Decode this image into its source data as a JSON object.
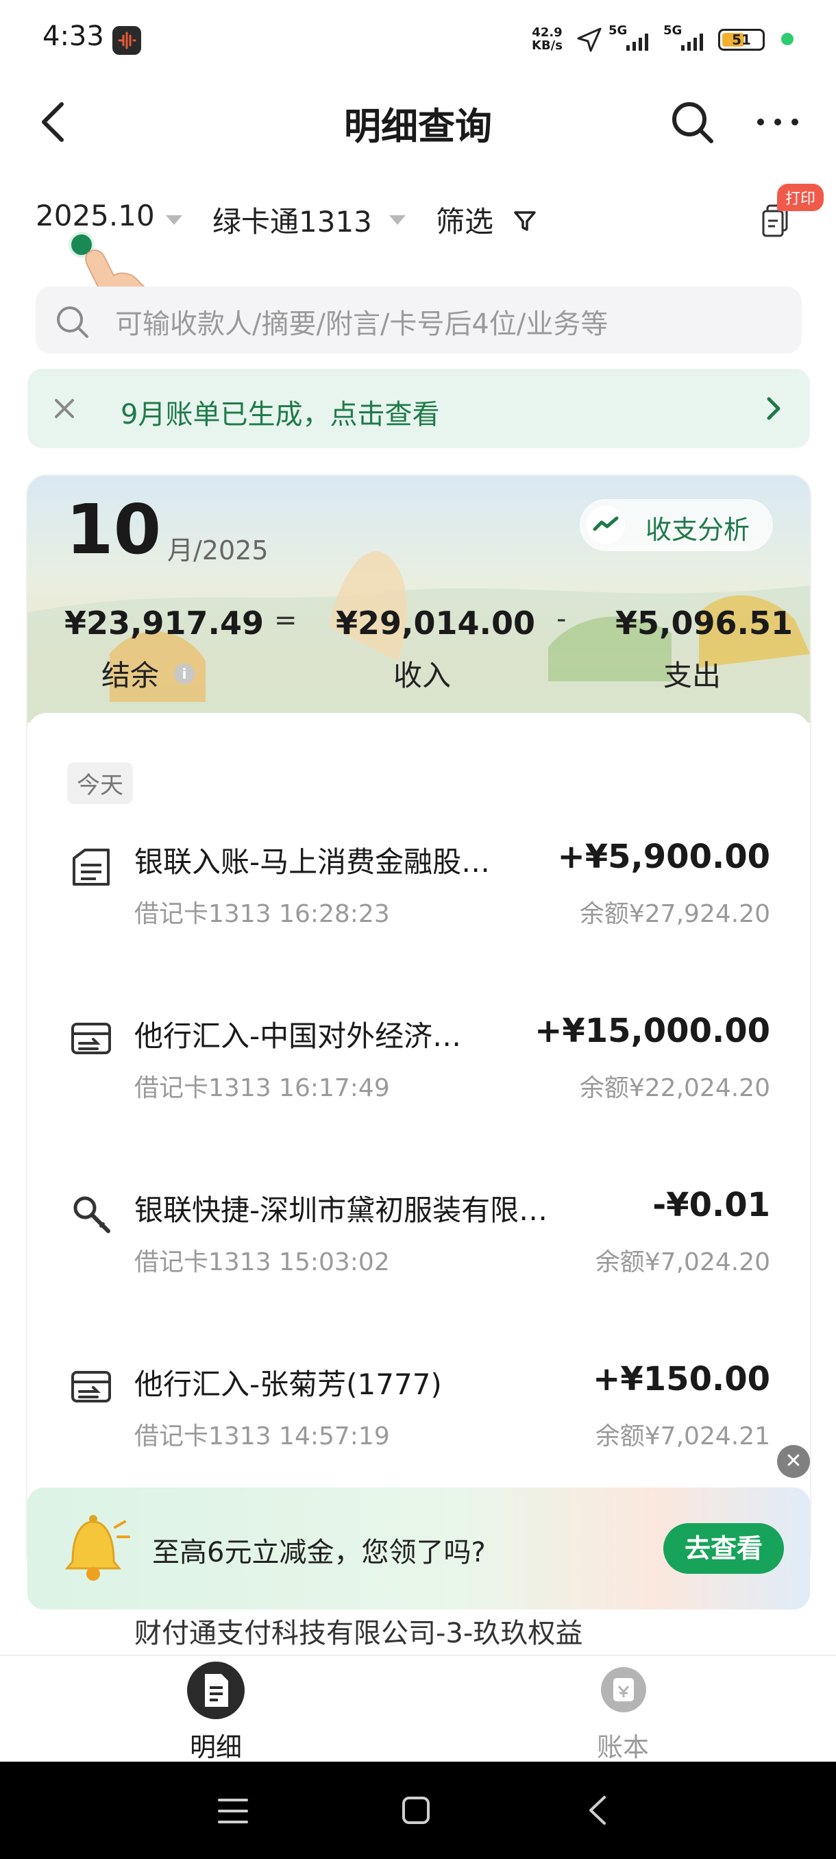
{
  "status_bar": {
    "time": "4:33",
    "net_speed_value": "42.9",
    "net_speed_unit": "KB/s",
    "signal_1": "5G",
    "signal_2": "5G",
    "battery": "51"
  },
  "header": {
    "title": "明细查询"
  },
  "filters": {
    "month": "2025.10",
    "card": "绿卡通1313",
    "filter_label": "筛选",
    "print_badge": "打印"
  },
  "search": {
    "placeholder": "可输收款人/摘要/附言/卡号后4位/业务等"
  },
  "notice": {
    "text": "9月账单已生成，点击查看"
  },
  "summary": {
    "month_number": "10",
    "month_suffix": "月/2025",
    "analysis_label": "收支分析",
    "balance_amount": "¥23,917.49",
    "balance_label": "结余",
    "income_amount": "¥29,014.00",
    "income_label": "收入",
    "expense_amount": "¥5,096.51",
    "expense_label": "支出",
    "equals_sign": "=",
    "minus_sign": "-"
  },
  "transactions": {
    "group_label": "今天",
    "items": [
      {
        "icon": "bank-transfer-icon",
        "title": "银联入账-马上消费金融股…",
        "detail": "借记卡1313 16:28:23",
        "amount": "+¥5,900.00",
        "balance": "余额¥27,924.20"
      },
      {
        "icon": "transfer-card-icon",
        "title": "他行汇入-中国对外经济…",
        "detail": "借记卡1313 16:17:49",
        "amount": "+¥15,000.00",
        "balance": "余额¥22,024.20"
      },
      {
        "icon": "search-pay-icon",
        "title": "银联快捷-深圳市黛初服装有限…",
        "detail": "借记卡1313 15:03:02",
        "amount": "-¥0.01",
        "balance": "余额¥7,024.20"
      },
      {
        "icon": "transfer-card-icon",
        "title": "他行汇入-张菊芳(1777)",
        "detail": "借记卡1313 14:57:19",
        "amount": "+¥150.00",
        "balance": "余额¥7,024.21"
      }
    ],
    "partial_next": "财付通支付科技有限公司-3-玖玖权益"
  },
  "promo": {
    "text": "至高6元立减金，您领了吗?",
    "button": "去查看"
  },
  "bottom_nav": {
    "items": [
      {
        "label": "明细",
        "active": true
      },
      {
        "label": "账本",
        "active": false
      }
    ]
  },
  "colors": {
    "accent_green": "#1f7a4a",
    "button_green": "#17a35a",
    "badge_red": "#f05a4a"
  }
}
